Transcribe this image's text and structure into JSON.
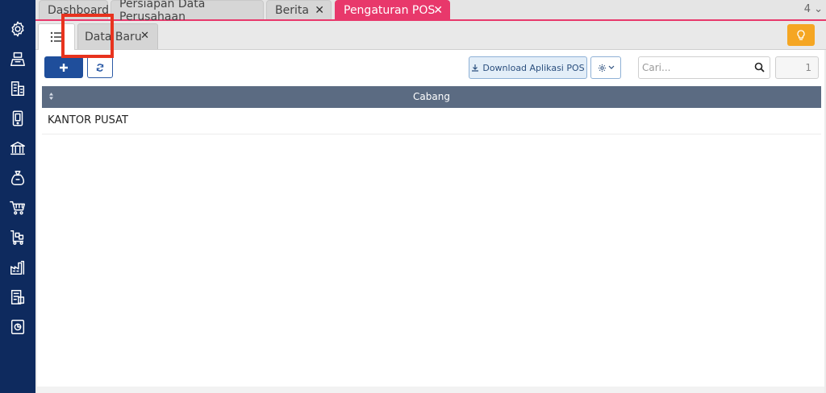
{
  "tabs": [
    {
      "label": "Dashboard",
      "active": false,
      "closable": false
    },
    {
      "label": "Persiapan Data Perusahaan",
      "active": false,
      "closable": false
    },
    {
      "label": "Berita",
      "active": false,
      "closable": true
    },
    {
      "label": "Pengaturan POS",
      "active": true,
      "closable": true
    }
  ],
  "tab_count": "4",
  "tab_close_glyph": "✕",
  "subtabs": {
    "list_icon": "list-icon",
    "data_baru": "Data Baru",
    "close_glyph": "✕"
  },
  "sidebar_icons": [
    "gear-icon",
    "cashier-icon",
    "building-icon",
    "mobile-device-icon",
    "bank-icon",
    "money-bag-icon",
    "shopping-cart-icon",
    "cart-trolley-icon",
    "factory-icon",
    "tax-document-icon",
    "report-icon"
  ],
  "toolbar": {
    "download_label": "Download Aplikasi POS",
    "search_placeholder": "Cari...",
    "page_number": "1"
  },
  "grid": {
    "column_header": "Cabang",
    "rows": [
      {
        "cabang": "KANTOR PUSAT"
      }
    ]
  },
  "colors": {
    "sidebar": "#0e2a5e",
    "accent_tab": "#e8386b",
    "primary_button": "#1f4e9b",
    "warning_button": "#f5a623",
    "grid_header": "#5b6b82",
    "highlight": "#e8331e"
  }
}
